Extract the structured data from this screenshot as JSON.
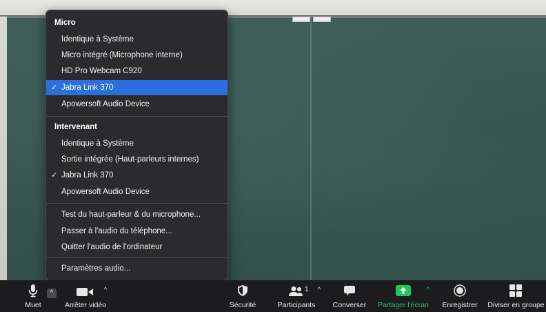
{
  "menu": {
    "sections": [
      {
        "header": "Micro",
        "items": [
          {
            "label": "Identique à Système",
            "checked": false,
            "selected": false
          },
          {
            "label": "Micro intégré (Microphone interne)",
            "checked": false,
            "selected": false
          },
          {
            "label": "HD Pro Webcam C920",
            "checked": false,
            "selected": false
          },
          {
            "label": "Jabra Link 370",
            "checked": true,
            "selected": true
          },
          {
            "label": "Apowersoft Audio Device",
            "checked": false,
            "selected": false
          }
        ]
      },
      {
        "header": "Intervenant",
        "items": [
          {
            "label": "Identique à Système",
            "checked": false
          },
          {
            "label": "Sortie intégrée (Haut-parleurs internes)",
            "checked": false
          },
          {
            "label": "Jabra Link 370",
            "checked": true
          },
          {
            "label": "Apowersoft Audio Device",
            "checked": false
          }
        ]
      }
    ],
    "actions": [
      "Test du haut-parleur & du microphone...",
      "Passer à l'audio du téléphone...",
      "Quitter l'audio de l'ordinateur"
    ],
    "settings": "Paramètres audio...",
    "check_glyph": "✓"
  },
  "toolbar": {
    "mute": {
      "label": "Muet",
      "icon": "microphone-icon"
    },
    "video": {
      "label": "Arrêter vidéo",
      "icon": "video-camera-icon"
    },
    "security": {
      "label": "Sécurité",
      "icon": "shield-icon"
    },
    "participants": {
      "label": "Participants",
      "count": "1",
      "icon": "participants-icon"
    },
    "chat": {
      "label": "Converser",
      "icon": "chat-bubble-icon"
    },
    "share": {
      "label": "Partager l'écran",
      "icon": "share-screen-icon",
      "color": "#23c45e"
    },
    "record": {
      "label": "Enregistrer",
      "icon": "record-icon"
    },
    "breakout": {
      "label": "Diviser en groupe",
      "icon": "breakout-rooms-icon"
    }
  },
  "colors": {
    "menu_bg": "#2b2b2d",
    "selected": "#2a6fdb",
    "toolbar_bg": "#1c1c1e",
    "share_green": "#23c45e"
  }
}
